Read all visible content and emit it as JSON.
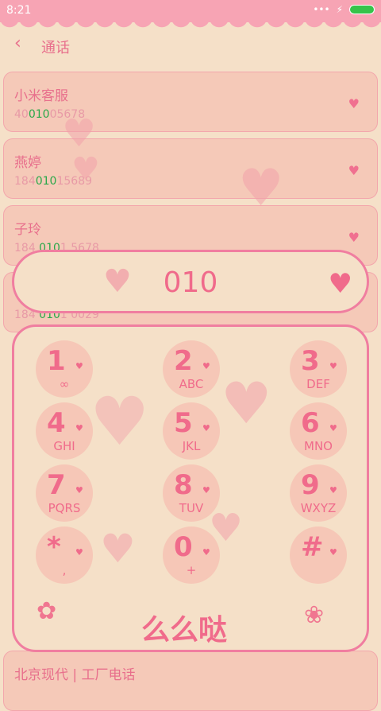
{
  "status_bar": {
    "time": "8:21",
    "dots": "•••",
    "signal": "⚡"
  },
  "header": {
    "back": "‹",
    "title": "通话"
  },
  "contacts": [
    {
      "name": "小米客服",
      "num_pre": "40",
      "num_hi": "010",
      "num_post": "05678"
    },
    {
      "name": "燕婷",
      "num_pre": "184",
      "num_hi": "010",
      "num_post": "15689"
    },
    {
      "name": "子玲",
      "num_pre": "184 ",
      "num_hi": "010",
      "num_post": "1 5678"
    },
    {
      "name": "",
      "num_pre": "184 ",
      "num_hi": "010",
      "num_post": "1 0029"
    },
    {
      "name": "北京现代 | 工厂电话",
      "num_pre": "",
      "num_hi": "",
      "num_post": ""
    }
  ],
  "dialer": {
    "digits": "010",
    "bottom_text": "么么哒"
  },
  "keys": [
    {
      "digit": "1",
      "letters": "∞"
    },
    {
      "digit": "2",
      "letters": "ABC"
    },
    {
      "digit": "3",
      "letters": "DEF"
    },
    {
      "digit": "4",
      "letters": "GHI"
    },
    {
      "digit": "5",
      "letters": "JKL"
    },
    {
      "digit": "6",
      "letters": "MNO"
    },
    {
      "digit": "7",
      "letters": "PQRS"
    },
    {
      "digit": "8",
      "letters": "TUV"
    },
    {
      "digit": "9",
      "letters": "WXYZ"
    },
    {
      "digit": "*",
      "letters": ","
    },
    {
      "digit": "0",
      "letters": "+"
    },
    {
      "digit": "#",
      "letters": ""
    }
  ],
  "colors": {
    "accent": "#f06b8b",
    "background": "#f5e0c8",
    "row_bg": "#f5c9b8",
    "highlight": "#2aa84a"
  }
}
